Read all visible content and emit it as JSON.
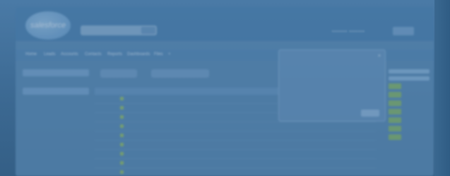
{
  "header": {
    "logo_text": "salesforce",
    "user_links": "▪▪▪▪▪▪▪ ▪▪▪▪▪▪▪",
    "setup_label": ""
  },
  "tabs": [
    "Home",
    "Leads",
    "Accounts",
    "Contacts",
    "Reports",
    "Dashboards",
    "Files",
    "+"
  ],
  "sidebar": {
    "items": [
      "",
      "",
      "",
      "",
      "",
      "",
      "",
      "",
      "",
      ""
    ]
  },
  "main": {
    "btn1": "",
    "btn2": "",
    "table_header": "",
    "rows": [
      {
        "a": "",
        "b": "",
        "c": "",
        "d": ""
      },
      {
        "a": "",
        "b": "",
        "c": "",
        "d": ""
      },
      {
        "a": "",
        "b": "",
        "c": "",
        "d": ""
      },
      {
        "a": "",
        "b": "",
        "c": "",
        "d": ""
      },
      {
        "a": "",
        "b": "",
        "c": "",
        "d": ""
      },
      {
        "a": "",
        "b": "",
        "c": "",
        "d": ""
      },
      {
        "a": "",
        "b": "",
        "c": "",
        "d": ""
      },
      {
        "a": "",
        "b": "",
        "c": "",
        "d": ""
      },
      {
        "a": "",
        "b": "",
        "c": "",
        "d": ""
      }
    ]
  },
  "popup": {
    "title": "",
    "close": "×",
    "lines": [
      "",
      "",
      "",
      "",
      "",
      ""
    ]
  },
  "colors": {
    "accent": "#4f84b3",
    "check": "#9dc46a"
  }
}
